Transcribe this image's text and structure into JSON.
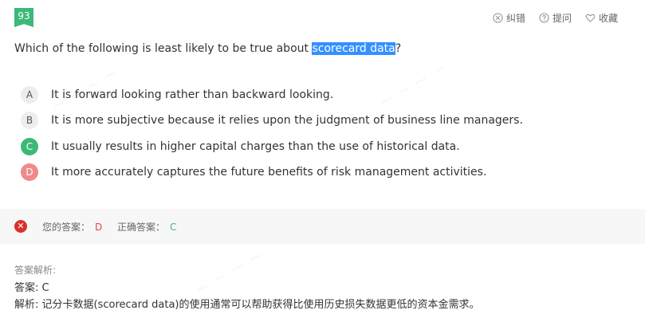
{
  "question": {
    "number": "93",
    "text_before": "Which of the following is least likely to be true about ",
    "highlight": "scorecard data",
    "text_after": "?"
  },
  "toolbar": {
    "correct_label": "纠错",
    "ask_label": "提问",
    "favorite_label": "收藏"
  },
  "options": [
    {
      "letter": "A",
      "text": "It is forward looking rather than backward looking.",
      "state": "normal"
    },
    {
      "letter": "B",
      "text": "It is more subjective because it relies upon the judgment of business line managers.",
      "state": "normal"
    },
    {
      "letter": "C",
      "text": "It usually results in higher capital charges than the use of historical data.",
      "state": "correct"
    },
    {
      "letter": "D",
      "text": "It more accurately captures the future benefits of risk management activities.",
      "state": "wrong"
    }
  ],
  "result": {
    "your_answer_label": "您的答案：",
    "your_answer": "D",
    "correct_answer_label": "正确答案：",
    "correct_answer": "C"
  },
  "analysis": {
    "label": "答案解析:",
    "answer_line": "答案: C",
    "explanation": "解析: 记分卡数据(scorecard data)的使用通常可以帮助获得比使用历史损失数据更低的资本金需求。"
  },
  "colors": {
    "accent_green": "#3cb878",
    "wrong_red": "#e64340",
    "highlight_blue": "#3390ff"
  }
}
